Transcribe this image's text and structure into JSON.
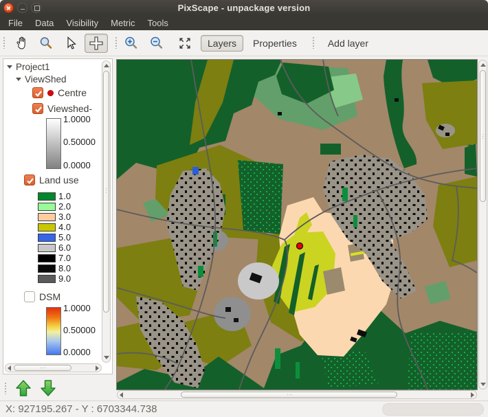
{
  "window": {
    "title": "PixScape - unpackage version"
  },
  "menubar": {
    "items": [
      "File",
      "Data",
      "Visibility",
      "Metric",
      "Tools"
    ]
  },
  "toolbar": {
    "layers_label": "Layers",
    "properties_label": "Properties",
    "add_layer_label": "Add layer",
    "active_tool": "crosshair"
  },
  "tree": {
    "project": "Project1",
    "group": "ViewShed",
    "centre": {
      "label": "Centre",
      "checked": true,
      "marker_color": "#e60000"
    },
    "viewshed": {
      "label": "Viewshed-",
      "checked": true,
      "scale_max": "1.0000",
      "scale_mid": "0.50000",
      "scale_min": "0.0000"
    },
    "land_use": {
      "label": "Land use",
      "checked": true,
      "classes": [
        {
          "value": "1.0",
          "color": "#00882d"
        },
        {
          "value": "2.0",
          "color": "#98fb98"
        },
        {
          "value": "3.0",
          "color": "#ffcc9e"
        },
        {
          "value": "4.0",
          "color": "#c8c800"
        },
        {
          "value": "5.0",
          "color": "#3566e8"
        },
        {
          "value": "6.0",
          "color": "#c8c8c8"
        },
        {
          "value": "7.0",
          "color": "#000000"
        },
        {
          "value": "8.0",
          "color": "#0a0a0a"
        },
        {
          "value": "9.0",
          "color": "#5a5a5a"
        }
      ]
    },
    "dsm": {
      "label": "DSM",
      "checked": false,
      "scale_max": "1.0000",
      "scale_mid": "0.50000",
      "scale_min": "0.0000"
    }
  },
  "map": {
    "marker": {
      "name": "centre-point",
      "color": "#ee0000"
    },
    "palette": {
      "forest": "#14602a",
      "field_tan": "#a28769",
      "field_olive": "#7d7f10",
      "meadow": "#639f6a",
      "visible_over_field": "#cbd421",
      "visible_over_open": "#fcd8b0",
      "urban": "#9a9488",
      "road": "#5c5c5c",
      "water": "#2a5fd7",
      "scrub": "#12b14a"
    }
  },
  "statusbar": {
    "coordinates": "X: 927195.267 - Y : 6703344.738"
  }
}
